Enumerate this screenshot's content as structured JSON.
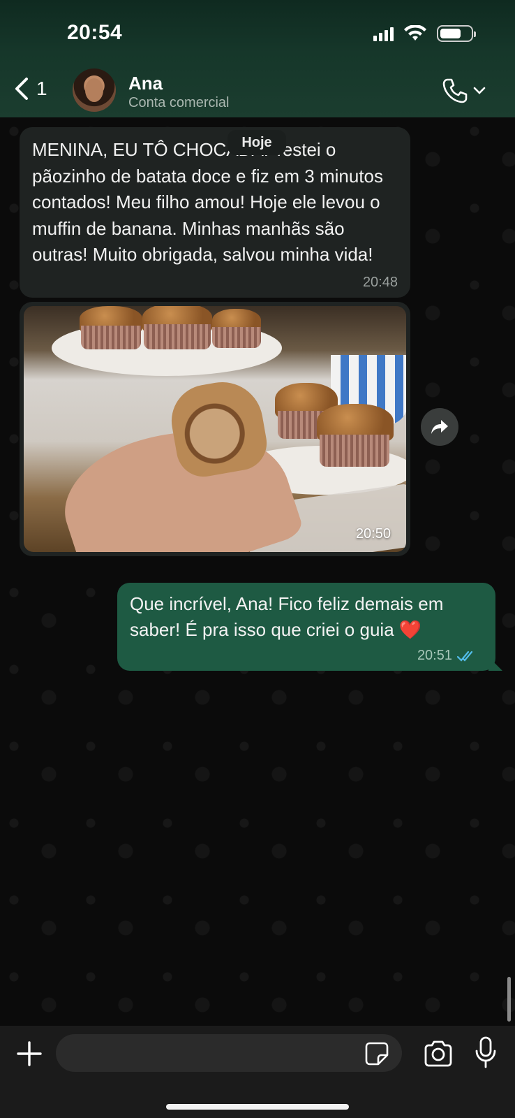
{
  "status_bar": {
    "time": "20:54",
    "icons": [
      "cellular-signal-icon",
      "wifi-icon",
      "battery-icon"
    ]
  },
  "header": {
    "back_count": "1",
    "contact_name": "Ana",
    "contact_subtitle": "Conta comercial",
    "icons": [
      "chevron-left-icon",
      "phone-icon",
      "chevron-down-icon"
    ]
  },
  "chat": {
    "date_chip": "Hoje",
    "messages": [
      {
        "direction": "incoming",
        "type": "text",
        "text": "MENINA, EU TÔ CHOCADA! Testei o pãozinho de batata doce e fiz em 3 minutos contados! Meu filho amou! Hoje ele levou o muffin de banana. Minhas manhãs são outras! Muito obrigada, salvou minha vida!",
        "time": "20:48"
      },
      {
        "direction": "incoming",
        "type": "image",
        "image_description": "hand holding a half-eaten banana muffin with more muffins on plates behind",
        "time": "20:50"
      },
      {
        "direction": "outgoing",
        "type": "text",
        "text": "Que incrível, Ana! Fico feliz demais em saber! É pra isso que criei o guia ❤️",
        "time": "20:51",
        "status": "read"
      }
    ]
  },
  "composer": {
    "input_value": "",
    "icons": [
      "plus-icon",
      "sticker-icon",
      "camera-icon",
      "microphone-icon"
    ]
  },
  "colors": {
    "header_bg": "#16372a",
    "incoming_bubble": "#1f2322",
    "outgoing_bubble": "#1e5a43",
    "read_receipt": "#53bdeb",
    "chat_bg": "#0b0b0b"
  }
}
